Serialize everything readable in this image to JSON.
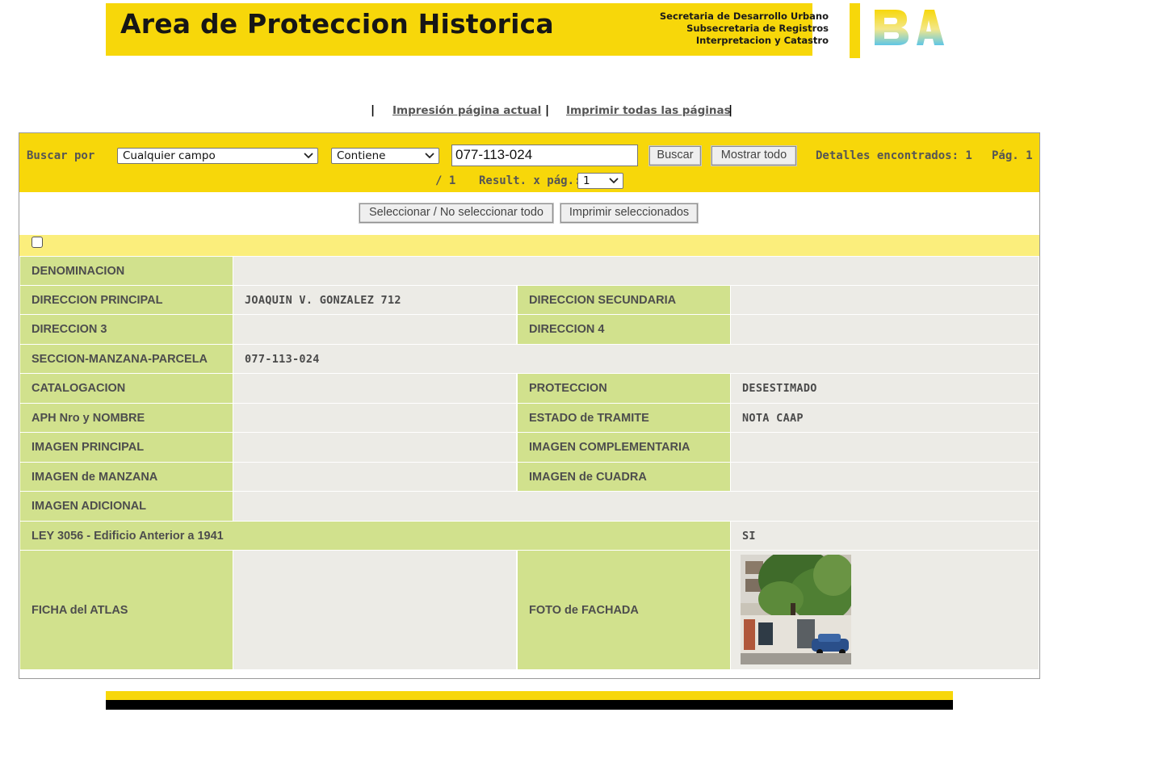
{
  "header": {
    "title": "Area de Proteccion Historica",
    "sub_lines": [
      "Secretaria de Desarrollo Urbano",
      "Subsecretaria de Registros",
      "Interpretacion y Catastro"
    ],
    "logo_text": "BA"
  },
  "print_links": {
    "current": "Impresión página actual",
    "all": "Imprimir todas las páginas"
  },
  "search": {
    "label": "Buscar por",
    "field_select": "Cualquier campo",
    "operator_select": "Contiene",
    "query": "077-113-024",
    "search_button": "Buscar",
    "show_all_button": "Mostrar todo",
    "found_text": "Detalles encontrados: 1",
    "page_label": "Pág. 1",
    "page_total": "/ 1",
    "per_page_label": "Result. x pág.:",
    "per_page_value": "1"
  },
  "actions": {
    "select_all": "Seleccionar / No seleccionar todo",
    "print_selected": "Imprimir seleccionados"
  },
  "record": {
    "denominacion": {
      "label": "DENOMINACION",
      "value": ""
    },
    "direccion_principal": {
      "label": "DIRECCION PRINCIPAL",
      "value": "JOAQUIN V. GONZALEZ 712"
    },
    "direccion_secundaria": {
      "label": "DIRECCION SECUNDARIA",
      "value": ""
    },
    "direccion_3": {
      "label": "DIRECCION 3",
      "value": ""
    },
    "direccion_4": {
      "label": "DIRECCION 4",
      "value": ""
    },
    "smp": {
      "label": "SECCION-MANZANA-PARCELA",
      "value": "077-113-024"
    },
    "catalogacion": {
      "label": "CATALOGACION",
      "value": ""
    },
    "proteccion": {
      "label": "PROTECCION",
      "value": "DESESTIMADO"
    },
    "aph": {
      "label": "APH Nro y NOMBRE",
      "value": ""
    },
    "estado": {
      "label": "ESTADO de TRAMITE",
      "value": "NOTA CAAP"
    },
    "imagen_principal": {
      "label": "IMAGEN PRINCIPAL",
      "value": ""
    },
    "imagen_complementaria": {
      "label": "IMAGEN COMPLEMENTARIA",
      "value": ""
    },
    "imagen_manzana": {
      "label": "IMAGEN de MANZANA",
      "value": ""
    },
    "imagen_cuadra": {
      "label": "IMAGEN de CUADRA",
      "value": ""
    },
    "imagen_adicional": {
      "label": "IMAGEN ADICIONAL",
      "value": ""
    },
    "ley_3056": {
      "label": "LEY 3056 - Edificio Anterior a 1941",
      "value": "SI"
    },
    "ficha_atlas": {
      "label": "FICHA del ATLAS",
      "value": ""
    },
    "foto_fachada": {
      "label": "FOTO de FACHADA",
      "photo": "facade-photo"
    }
  },
  "colors": {
    "brand_yellow": "#f7d70a",
    "label_green": "#d1e18d",
    "value_gray": "#ecebe6",
    "strip_yellow": "#fbee7c"
  }
}
